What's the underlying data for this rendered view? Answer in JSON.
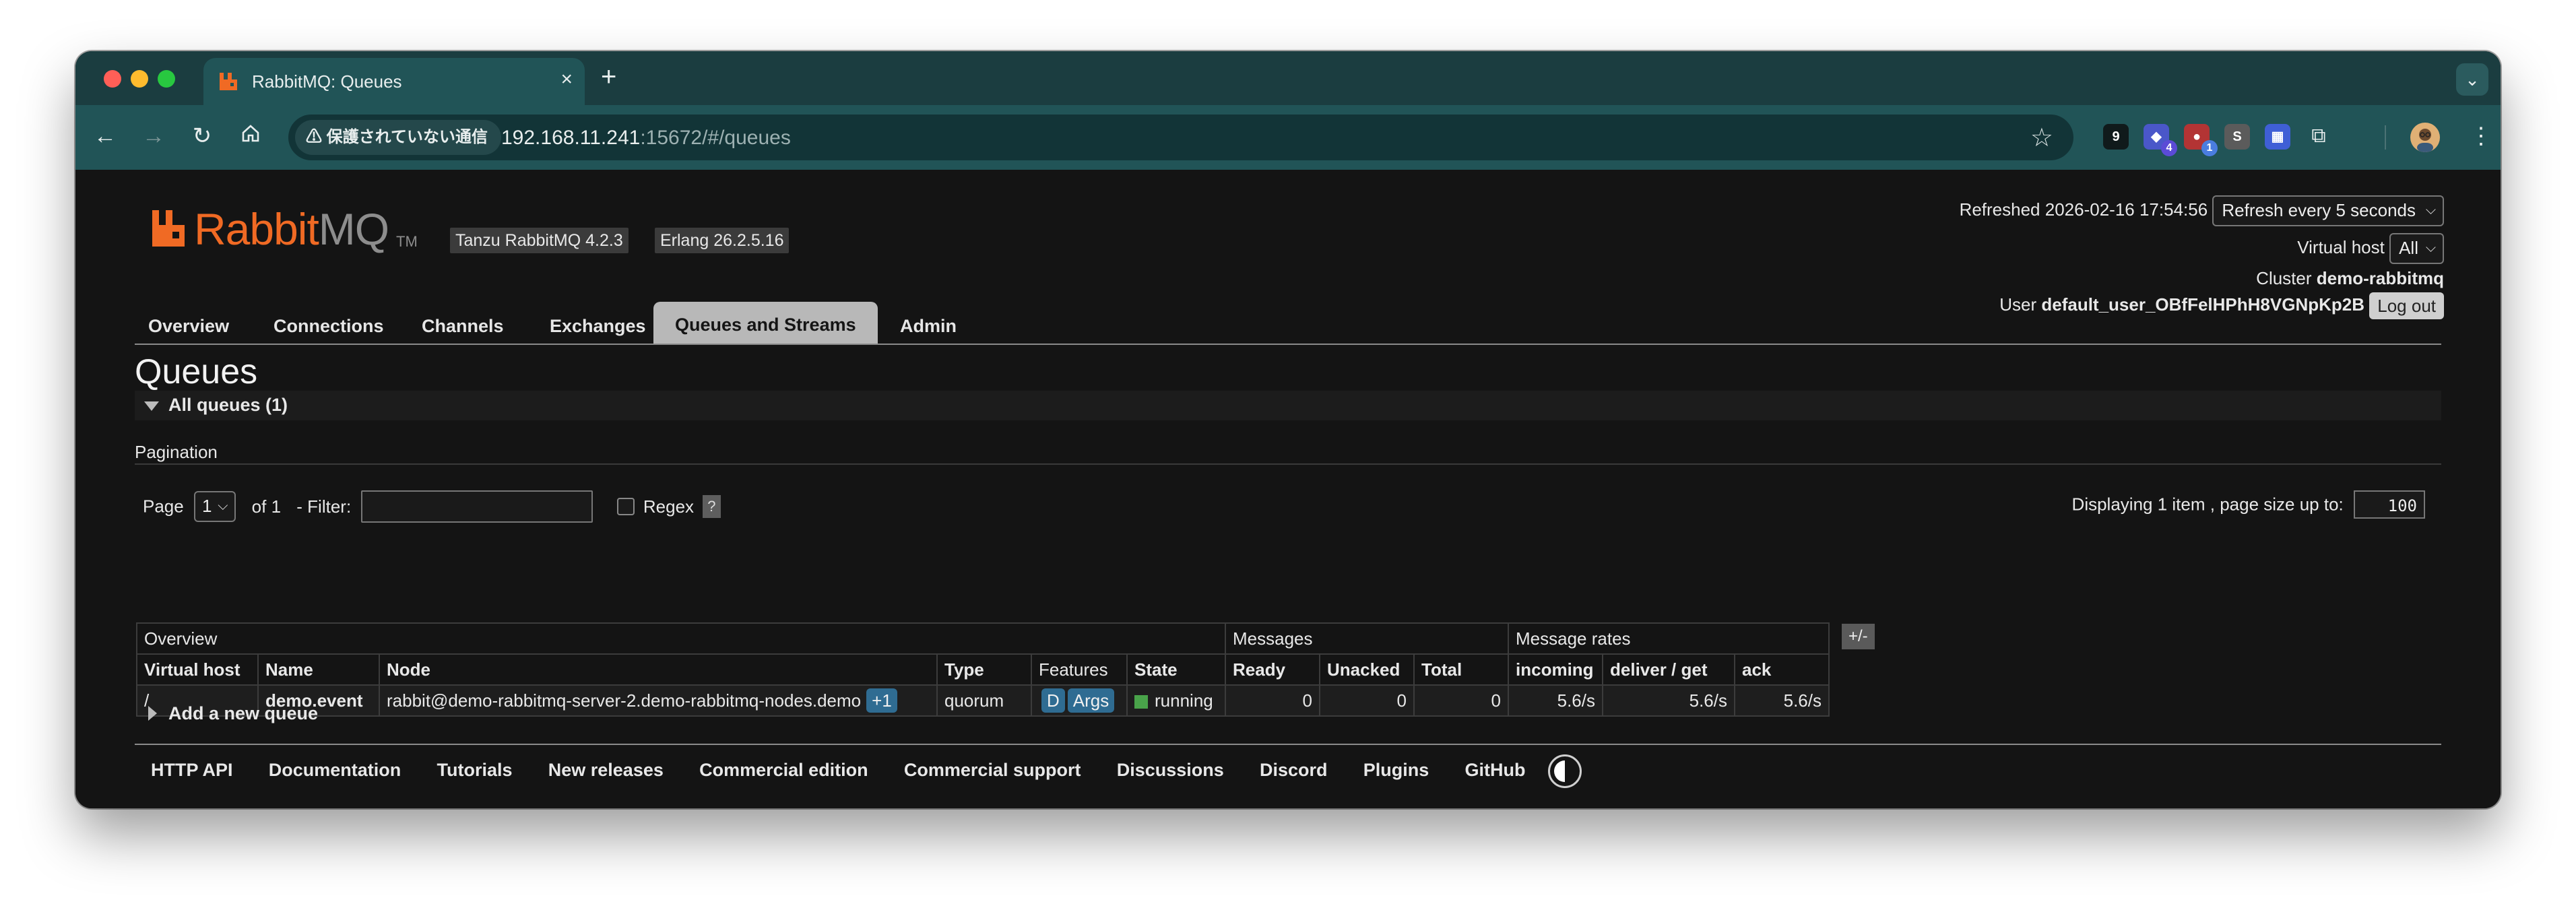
{
  "browser": {
    "tab_title": "RabbitMQ: Queues",
    "security_chip": "保護されていない通信",
    "url_host": "192.168.11.241",
    "url_rest": ":15672/#/queues",
    "extensions": [
      {
        "name": "extension-1",
        "label": "9",
        "color": "#1c1c1c",
        "badge": ""
      },
      {
        "name": "extension-2",
        "label": "◆",
        "color": "#4a57c9",
        "badge": "4"
      },
      {
        "name": "extension-3",
        "label": "●",
        "color": "#b33434",
        "badge": "1"
      },
      {
        "name": "extension-4",
        "label": "S",
        "color": "#5b5b5b",
        "badge": ""
      },
      {
        "name": "extension-5",
        "label": "▦",
        "color": "#3f5fd6",
        "badge": ""
      }
    ]
  },
  "header": {
    "logo_word_main": "RabbitMQ",
    "logo_tm": "TM",
    "product_badge": "Tanzu RabbitMQ 4.2.3",
    "erlang_badge": "Erlang 26.2.5.16",
    "refreshed_label": "Refreshed 2026-02-16 17:54:56",
    "refresh_select": "Refresh every 5 seconds",
    "vhost_label": "Virtual host",
    "vhost_select": "All",
    "cluster_label": "Cluster",
    "cluster_name": "demo-rabbitmq",
    "user_label": "User",
    "user_name": "default_user_OBfFelHPhH8VGNpKp2B",
    "logout": "Log out"
  },
  "nav": {
    "tabs": [
      "Overview",
      "Connections",
      "Channels",
      "Exchanges",
      "Queues and Streams",
      "Admin"
    ],
    "active": "Queues and Streams"
  },
  "main": {
    "title": "Queues",
    "section": "All queues (1)",
    "pagination_label": "Pagination",
    "page_label": "Page",
    "page_value": "1",
    "of_label": "of 1",
    "filter_label": "- Filter:",
    "filter_value": "",
    "regex_label": "Regex",
    "regex_checked": false,
    "help": "?",
    "displaying_label": "Displaying 1 item , page size up to:",
    "page_size": "100",
    "table": {
      "groups": [
        "Overview",
        "Messages",
        "Message rates"
      ],
      "columns": [
        "Virtual host",
        "Name",
        "Node",
        "Type",
        "Features",
        "State",
        "Ready",
        "Unacked",
        "Total",
        "incoming",
        "deliver / get",
        "ack"
      ],
      "plus_minus": "+/-",
      "rows": [
        {
          "vhost": "/",
          "name": "demo.event",
          "node": "rabbit@demo-rabbitmq-server-2.demo-rabbitmq-nodes.demo",
          "node_extra": "+1",
          "type": "quorum",
          "features": [
            "D",
            "Args"
          ],
          "state": "running",
          "ready": "0",
          "unacked": "0",
          "total": "0",
          "incoming": "5.6/s",
          "deliver_get": "5.6/s",
          "ack": "5.6/s"
        }
      ]
    },
    "add_queue": "Add a new queue"
  },
  "footer": {
    "links": [
      "HTTP API",
      "Documentation",
      "Tutorials",
      "New releases",
      "Commercial edition",
      "Commercial support",
      "Discussions",
      "Discord",
      "Plugins",
      "GitHub"
    ]
  },
  "colors": {
    "accent_orange": "#f06a24",
    "state_running": "#49a34a",
    "feature_pill": "#2f6c92"
  }
}
